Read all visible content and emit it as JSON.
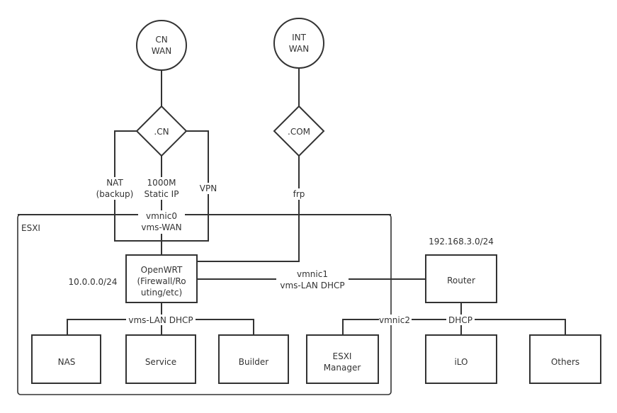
{
  "container": {
    "label": "ESXI"
  },
  "nodes": {
    "cn_wan": {
      "lines": [
        "CN",
        "WAN"
      ],
      "shape": "circle"
    },
    "int_wan": {
      "lines": [
        "INT",
        "WAN"
      ],
      "shape": "circle"
    },
    "cn_gate": {
      "lines": [
        ".CN"
      ],
      "shape": "diamond"
    },
    "com_gate": {
      "lines": [
        ".COM"
      ],
      "shape": "diamond"
    },
    "openwrt": {
      "lines": [
        "OpenWRT",
        "(Firewall/Ro",
        "uting/etc)"
      ],
      "shape": "rect"
    },
    "router": {
      "lines": [
        "Router"
      ],
      "shape": "rect"
    },
    "nas": {
      "lines": [
        "NAS"
      ],
      "shape": "rect"
    },
    "service": {
      "lines": [
        "Service"
      ],
      "shape": "rect"
    },
    "builder": {
      "lines": [
        "Builder"
      ],
      "shape": "rect"
    },
    "esxi_manager": {
      "lines": [
        "ESXI",
        "Manager"
      ],
      "shape": "rect"
    },
    "ilo": {
      "lines": [
        "iLO"
      ],
      "shape": "rect"
    },
    "others": {
      "lines": [
        "Others"
      ],
      "shape": "rect"
    }
  },
  "labels": {
    "nat": [
      "NAT",
      "(backup)"
    ],
    "static": [
      "1000M",
      "Static IP"
    ],
    "vpn": [
      "VPN"
    ],
    "frp": [
      "frp"
    ],
    "vmnic0": [
      "vmnic0",
      "vms-WAN"
    ],
    "vmnic1": [
      "vmnic1",
      "vms-LAN DHCP"
    ],
    "vmnic2": [
      "vmnic2"
    ],
    "dhcp": [
      "DHCP"
    ],
    "vms_lan": [
      "vms-LAN DHCP"
    ],
    "subnet_internal": [
      "10.0.0.0/24"
    ],
    "subnet_external": [
      "192.168.3.0/24"
    ]
  }
}
